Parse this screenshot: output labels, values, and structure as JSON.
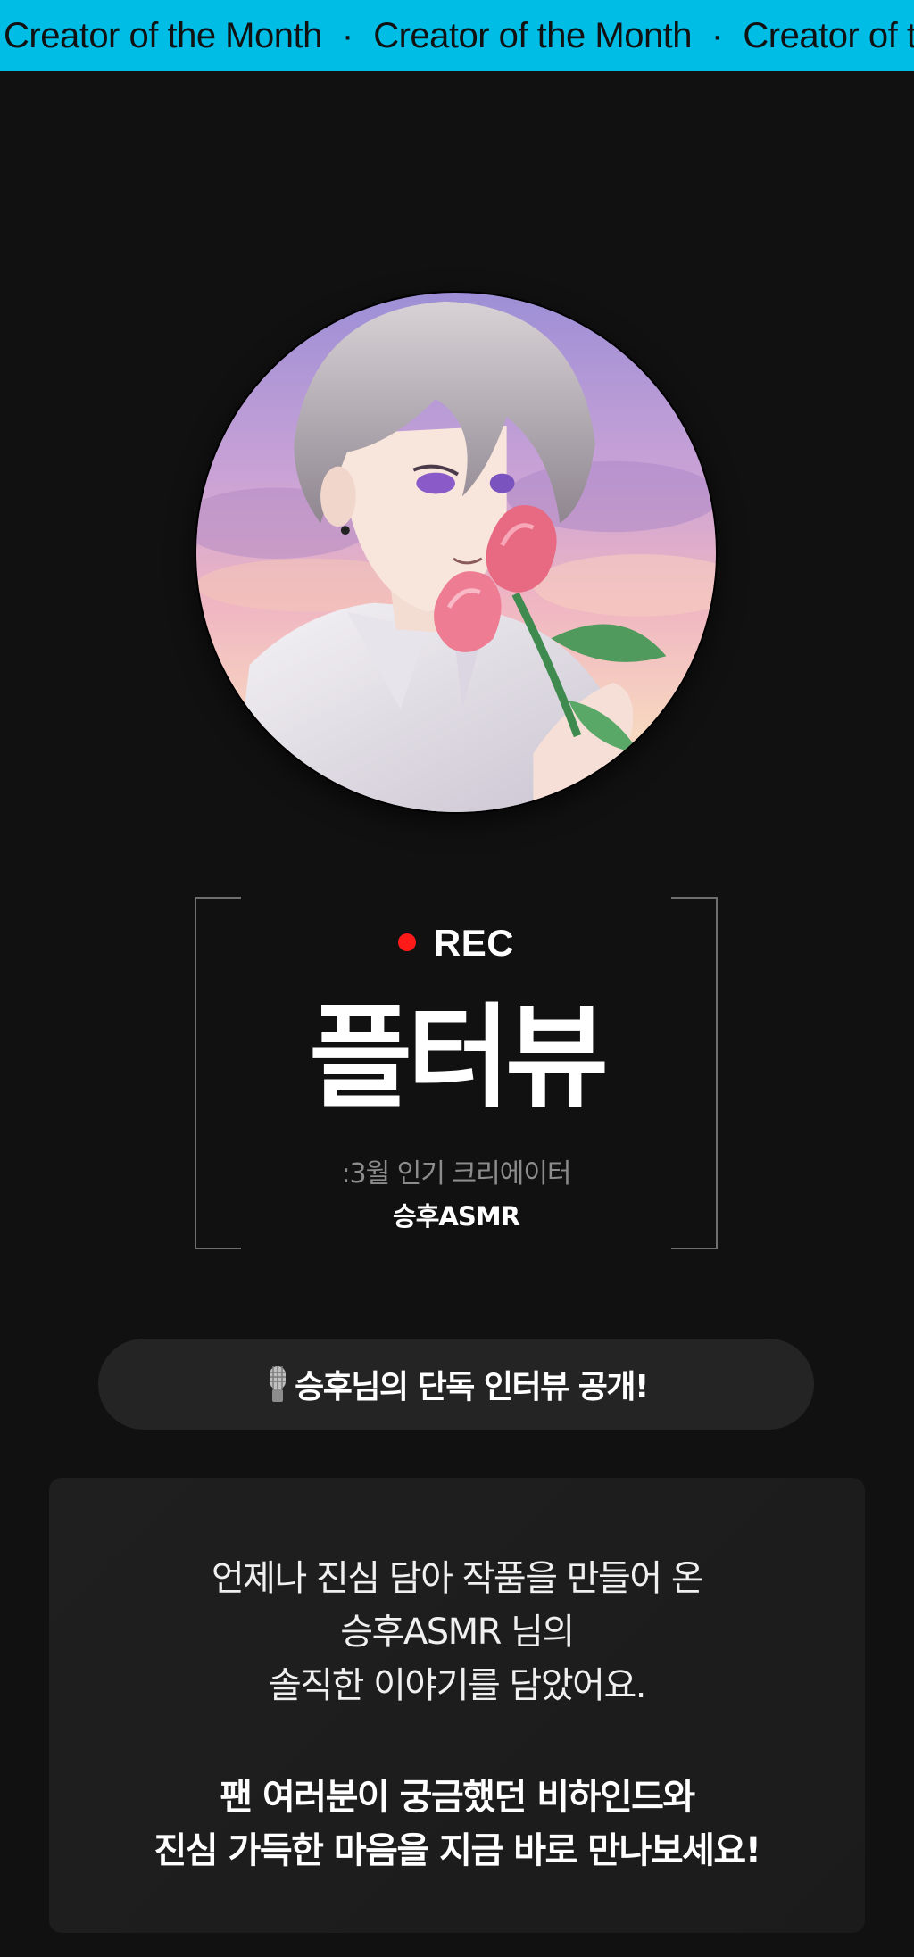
{
  "banner": {
    "items": [
      "Creator of the Month",
      "Creator of the Month",
      "Creator of the Month"
    ],
    "separator": "·",
    "background": "#00BDE6"
  },
  "hero": {
    "avatar_icon": "creator-profile-illustration"
  },
  "title_block": {
    "rec_label": "REC",
    "rec_dot_color": "#FF1A1A",
    "title": "플터뷰",
    "subtitle": ":3월 인기 크리에이터",
    "creator_name": "승후ASMR"
  },
  "interview_pill": {
    "icon": "microphone-icon",
    "label": "승후님의 단독 인터뷰 공개!"
  },
  "description": {
    "line1": "언제나 진심 담아 작품을 만들어 온",
    "line2": "승후ASMR 님의",
    "line3": "솔직한 이야기를 담았어요.",
    "bold_line1": "팬 여러분이 궁금했던 비하인드와",
    "bold_line2": "진심 가득한 마음을 지금 바로 만나보세요!"
  }
}
